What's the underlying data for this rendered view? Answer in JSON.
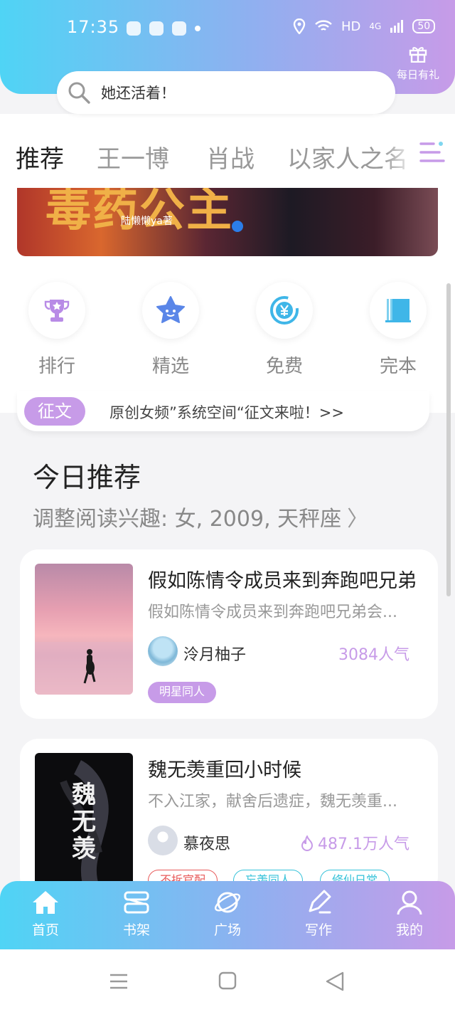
{
  "status_bar": {
    "time": "17:35",
    "network": "HD",
    "signal_type": "4G",
    "battery": "50"
  },
  "header": {
    "gift_label": "每日有礼"
  },
  "search": {
    "text": "她还活着！"
  },
  "tabs": [
    {
      "label": "推荐",
      "active": true
    },
    {
      "label": "王一博",
      "active": false
    },
    {
      "label": "肖战",
      "active": false
    },
    {
      "label": "以家人之名",
      "active": false
    }
  ],
  "banner": {
    "title_text": "毒药公主",
    "author": "陆懒懒ya著"
  },
  "quick_links": [
    {
      "label": "排行",
      "icon": "trophy-icon"
    },
    {
      "label": "精选",
      "icon": "star-icon"
    },
    {
      "label": "免费",
      "icon": "yen-icon"
    },
    {
      "label": "完本",
      "icon": "book-icon"
    }
  ],
  "notice": {
    "badge": "征文",
    "text": "原创女频”系统空间“征文来啦！>>"
  },
  "today": {
    "title": "今日推荐",
    "subtitle": "调整阅读兴趣: 女, 2009, 天秤座"
  },
  "books": [
    {
      "title": "假如陈情令成员来到奔跑吧兄弟",
      "desc": "假如陈情令成员来到奔跑吧兄弟会...",
      "author": "泠月柚子",
      "popularity": "3084人气",
      "tags": [
        "明星同人"
      ]
    },
    {
      "title": "魏无羡重回小时候",
      "desc": "不入江家，献舍后遗症，魏无羡重...",
      "author": "慕夜思",
      "popularity": "487.1万人气",
      "tags": [
        "不拆官配",
        "忘羡同人",
        "修仙日常"
      ],
      "cover_text": "魏无羡"
    }
  ],
  "bottom_nav": [
    {
      "label": "首页",
      "icon": "home-icon"
    },
    {
      "label": "书架",
      "icon": "bookshelf-icon"
    },
    {
      "label": "广场",
      "icon": "planet-icon"
    },
    {
      "label": "写作",
      "icon": "pen-icon"
    },
    {
      "label": "我的",
      "icon": "user-icon"
    }
  ],
  "colors": {
    "accent": "#c79be8",
    "gradient_start": "#4fd4f5",
    "gradient_end": "#c79be8"
  }
}
